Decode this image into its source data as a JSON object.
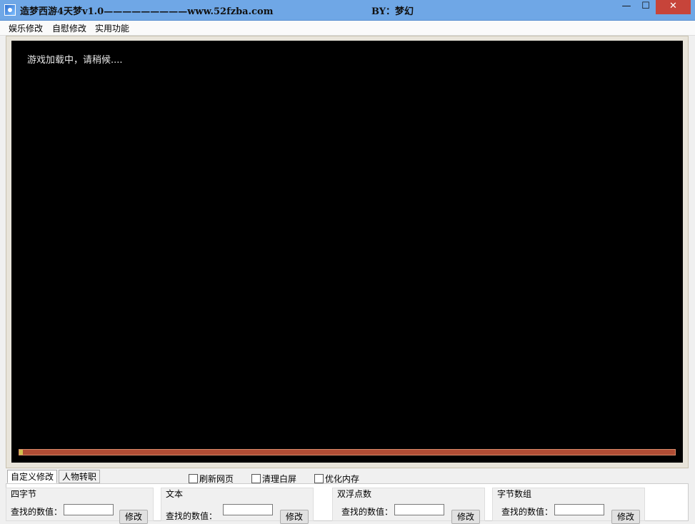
{
  "window": {
    "title": "造梦西游4天梦v1.0—————————www.52fzba.com",
    "author": "BY：梦幻",
    "minimize_label": "—",
    "maximize_label": "☐",
    "close_label": "✕"
  },
  "menu": [
    {
      "label": "娱乐修改"
    },
    {
      "label": "自慰修改"
    },
    {
      "label": "实用功能"
    }
  ],
  "game": {
    "loading_text": "游戏加载中，请稍候....",
    "progress_percent": 0.5
  },
  "tabs": [
    {
      "label": "自定义修改"
    },
    {
      "label": "人物转职"
    }
  ],
  "options": [
    {
      "label": "刷新网页"
    },
    {
      "label": "清理白屏"
    },
    {
      "label": "优化内存"
    }
  ],
  "groups": [
    {
      "title": "四字节",
      "label": "查找的数值：",
      "value": "",
      "button": "修改"
    },
    {
      "title": "文本",
      "label": "查找的数值：",
      "value": "",
      "button": "修改"
    },
    {
      "title": "双浮点数",
      "label": "查找的数值：",
      "value": "",
      "button": "修改"
    },
    {
      "title": "字节数组",
      "label": "查找的数值：",
      "value": "",
      "button": "修改"
    }
  ],
  "colors": {
    "titlebar": "#6fa7e6",
    "close_button": "#c7443a",
    "progress_track": "#b04d35",
    "game_background": "#000000"
  }
}
